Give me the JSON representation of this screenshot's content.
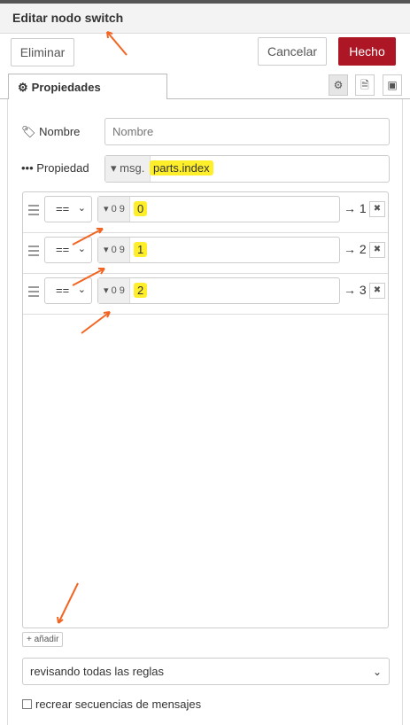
{
  "window": {
    "title": "Editar nodo switch"
  },
  "toolbar": {
    "delete_label": "Eliminar",
    "cancel_label": "Cancelar",
    "done_label": "Hecho"
  },
  "tabs": [
    {
      "label": "Propiedades",
      "icon": "gear-icon"
    }
  ],
  "tab_tools": [
    {
      "icon": "gear-icon",
      "active": true
    },
    {
      "icon": "document-icon",
      "active": false
    },
    {
      "icon": "appearance-icon",
      "active": false
    }
  ],
  "form": {
    "name": {
      "label": "Nombre",
      "placeholder": "Nombre",
      "value": ""
    },
    "property": {
      "label": "Propiedad",
      "type_prefix": "msg.",
      "value": "parts.index"
    }
  },
  "rules": [
    {
      "operator": "==",
      "type": "0 9",
      "value": "0",
      "output": "→ 1"
    },
    {
      "operator": "==",
      "type": "0 9",
      "value": "1",
      "output": "→ 2"
    },
    {
      "operator": "==",
      "type": "0 9",
      "value": "2",
      "output": "→ 3"
    }
  ],
  "add_button": {
    "label": "añadir"
  },
  "check_mode": {
    "selected": "revisando todas las reglas"
  },
  "recreate_sequences": {
    "label": "recrear secuencias de mensajes",
    "checked": false
  },
  "colors": {
    "primary": "#ad1625",
    "highlight": "#ffef2b",
    "annotation": "#f26522"
  }
}
